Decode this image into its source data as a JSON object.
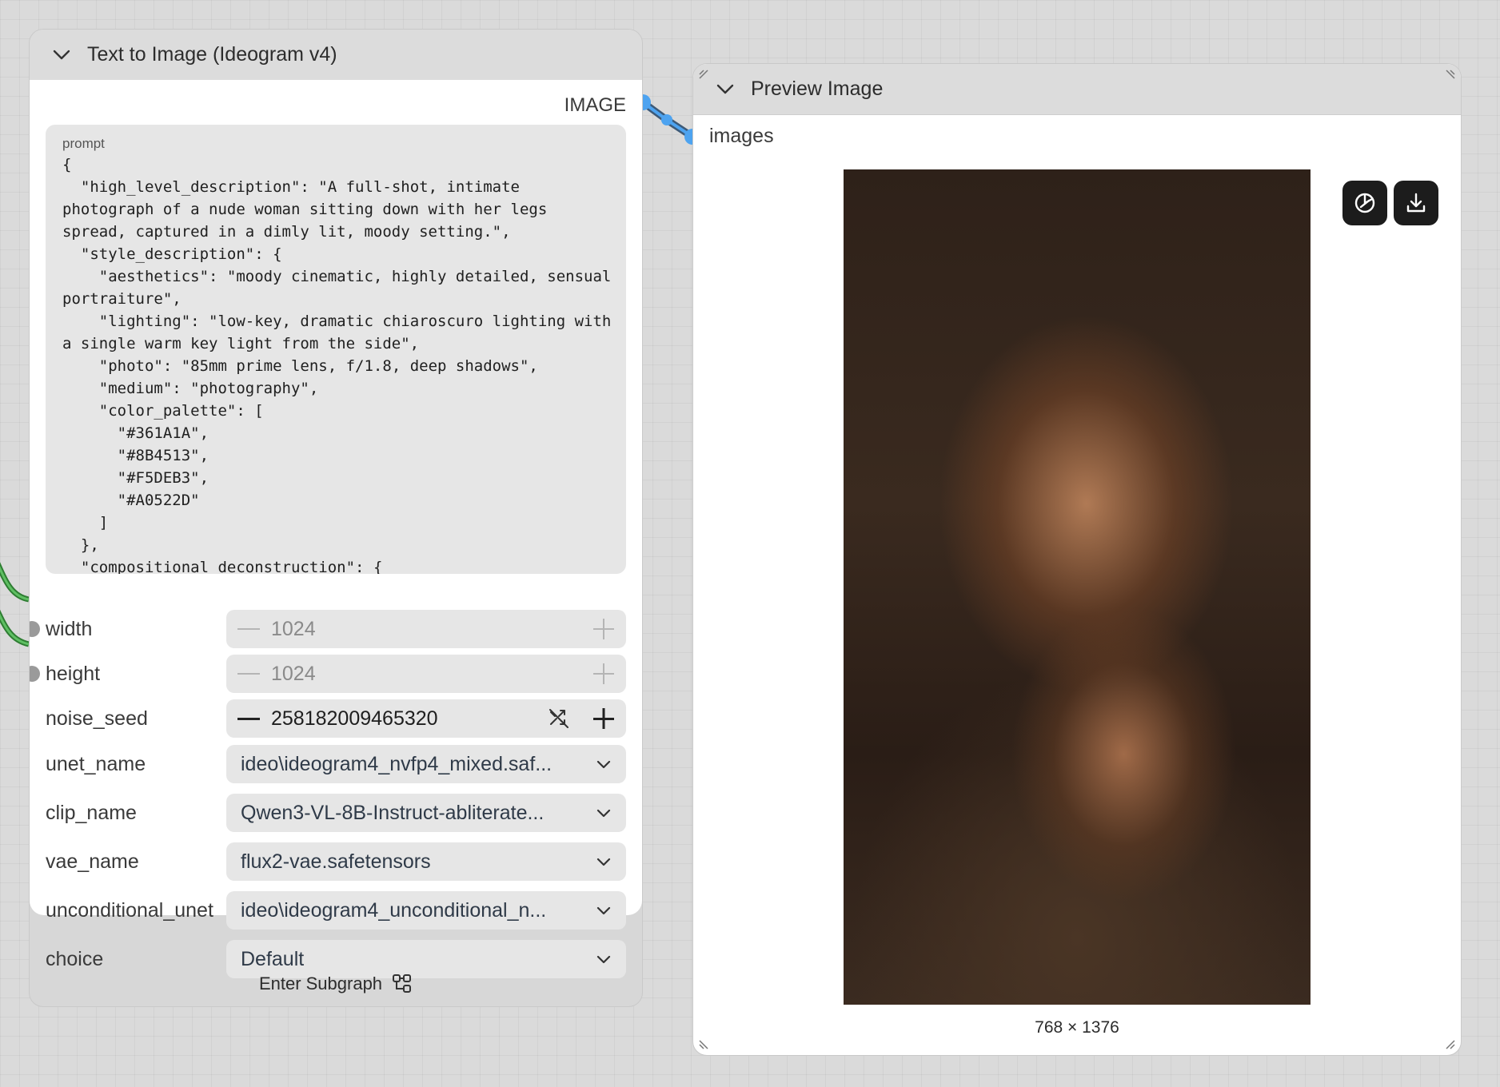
{
  "nodes": {
    "text_to_image": {
      "title": "Text to Image (Ideogram v4)",
      "output_label": "IMAGE",
      "prompt": {
        "label": "prompt",
        "value": "{\n  \"high_level_description\": \"A full-shot, intimate photograph of a nude woman sitting down with her legs spread, captured in a dimly lit, moody setting.\",\n  \"style_description\": {\n    \"aesthetics\": \"moody cinematic, highly detailed, sensual portraiture\",\n    \"lighting\": \"low-key, dramatic chiaroscuro lighting with a single warm key light from the side\",\n    \"photo\": \"85mm prime lens, f/1.8, deep shadows\",\n    \"medium\": \"photography\",\n    \"color_palette\": [\n      \"#361A1A\",\n      \"#8B4513\",\n      \"#F5DEB3\",\n      \"#A0522D\"\n    ]\n  },\n  \"compositional_deconstruction\": {"
      },
      "widgets": {
        "width": {
          "label": "width",
          "value": "1024"
        },
        "height": {
          "label": "height",
          "value": "1024"
        },
        "noise_seed": {
          "label": "noise_seed",
          "value": "258182009465320"
        },
        "unet_name": {
          "label": "unet_name",
          "value": "ideo\\ideogram4_nvfp4_mixed.saf..."
        },
        "clip_name": {
          "label": "clip_name",
          "value": "Qwen3-VL-8B-Instruct-abliterate..."
        },
        "vae_name": {
          "label": "vae_name",
          "value": "flux2-vae.safetensors"
        },
        "unconditional_unet": {
          "label": "unconditional_unet",
          "value": "ideo\\ideogram4_unconditional_n..."
        },
        "choice": {
          "label": "choice",
          "value": "Default"
        }
      },
      "footer_button": "Enter Subgraph"
    },
    "preview_image": {
      "title": "Preview Image",
      "input_label": "images",
      "image_dimensions": "768 × 1376",
      "actions": [
        "mask-editor-icon",
        "download-icon"
      ]
    }
  },
  "colors": {
    "image_link": "#4da3f0",
    "int_link": "#4caf50",
    "canvas": "#dadada"
  }
}
